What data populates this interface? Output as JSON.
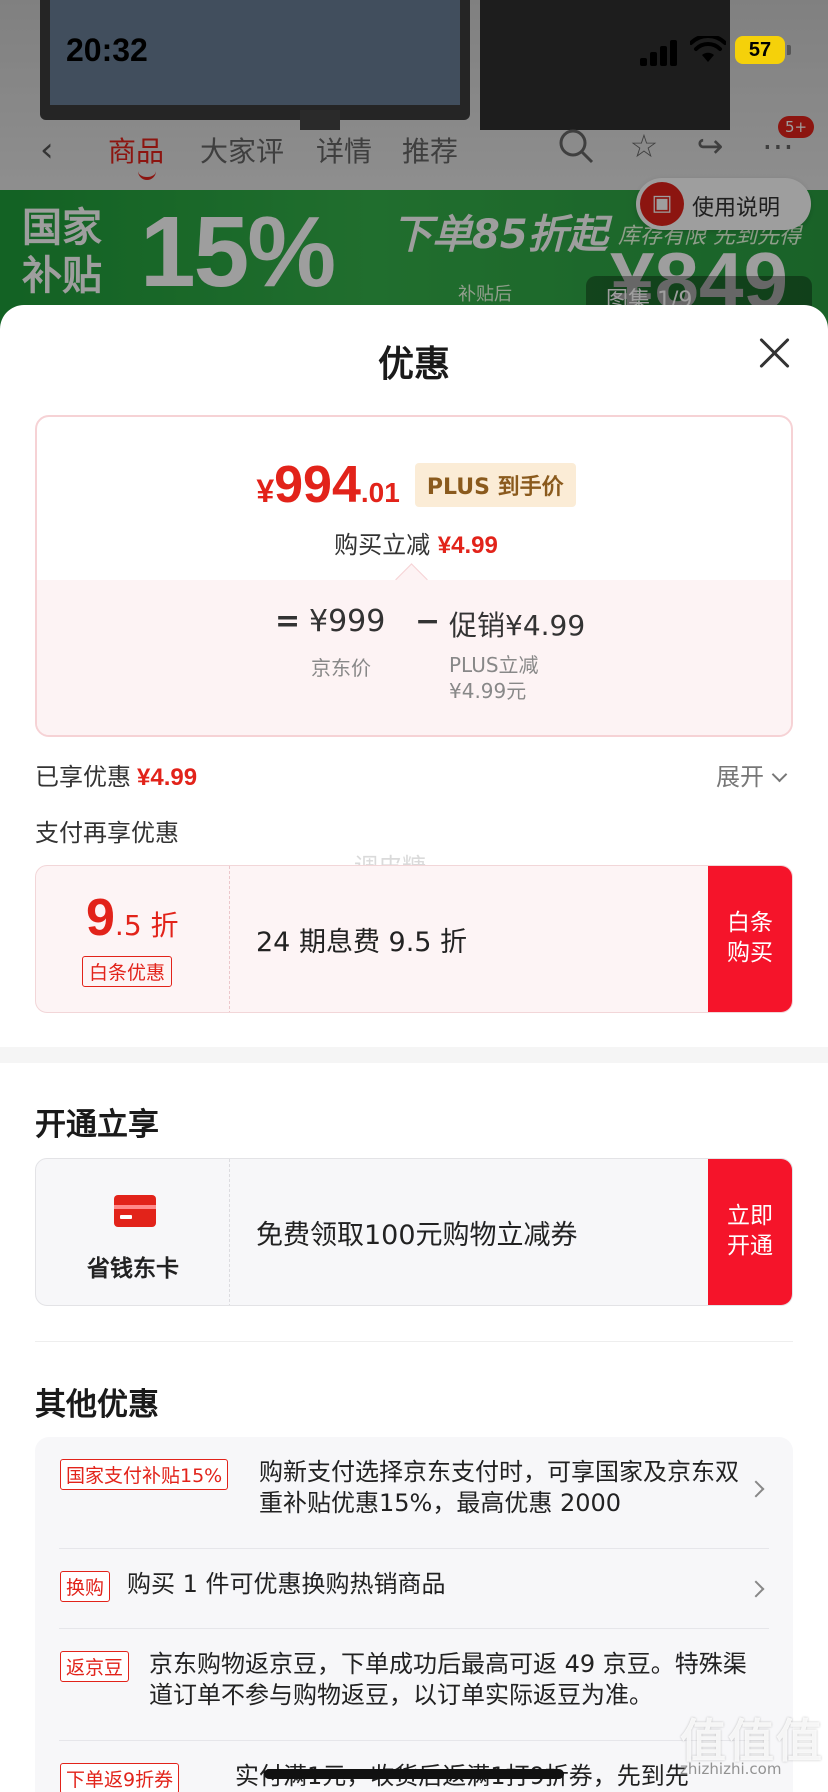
{
  "status_bar": {
    "time": "20:32",
    "battery": "57"
  },
  "background_page": {
    "tabs": [
      "商品",
      "大家评",
      "详情",
      "推荐"
    ],
    "badge": "5+",
    "help_button": "使用说明",
    "banner": {
      "subsidy": "国家\n补贴",
      "percent": "15%",
      "slogan": "下单85折起",
      "stock": "库存有限 先到先得",
      "after_subsidy": "补贴后",
      "price_partial": "¥849"
    },
    "gallery": "图集 1/9"
  },
  "sheet": {
    "title": "优惠",
    "price_card": {
      "yen": "¥",
      "price_int": "994",
      "price_dec": ".01",
      "plus_tag": "PLUS 到手价",
      "reduce_label": "购买立减",
      "reduce_value": "¥4.99",
      "calc": {
        "equals": "=",
        "jd_price": "¥999",
        "minus": "−",
        "promo_label": "促销",
        "promo_value": "¥4.99",
        "jd_price_label": "京东价",
        "plus_reduce_line1": "PLUS立减",
        "plus_reduce_line2": "¥4.99元"
      }
    },
    "enjoyed_label": "已享优惠",
    "enjoyed_value": "¥4.99",
    "expand_label": "展开",
    "pay_title": "支付再享优惠",
    "watermark": "调皮糖",
    "baitiao": {
      "discount_int": "9",
      "discount_suffix": ".5 折",
      "tag": "白条优惠",
      "desc": "24 期息费 9.5 折",
      "button": "白条\n购买"
    },
    "open_section_title": "开通立享",
    "dongka": {
      "name": "省钱东卡",
      "desc": "免费领取100元购物立减券",
      "button": "立即\n开通"
    },
    "other_section_title": "其他优惠",
    "other_items": [
      {
        "tag": "国家支付补贴15%",
        "text": "购新支付选择京东支付时，可享国家及京东双重补贴优惠15%，最高优惠 2000"
      },
      {
        "tag": "换购",
        "text": "购买 1 件可优惠换购热销商品"
      },
      {
        "tag": "返京豆",
        "text": "京东购物返京豆，下单成功后最高可返 49 京豆。特殊渠道订单不参与购物返豆，以订单实际返豆为准。"
      },
      {
        "tag": "下单返9折券",
        "text": "实付满1元，收货后返满1打9折券，先到先"
      }
    ]
  },
  "site_watermark": {
    "mark": "值值值",
    "url": "zhizhizhi.com"
  },
  "colors": {
    "accent": "#e2231a",
    "button_red": "#f5142a",
    "subsidy_green": "#2aa843",
    "plus_gold": "#8a5a1d"
  }
}
